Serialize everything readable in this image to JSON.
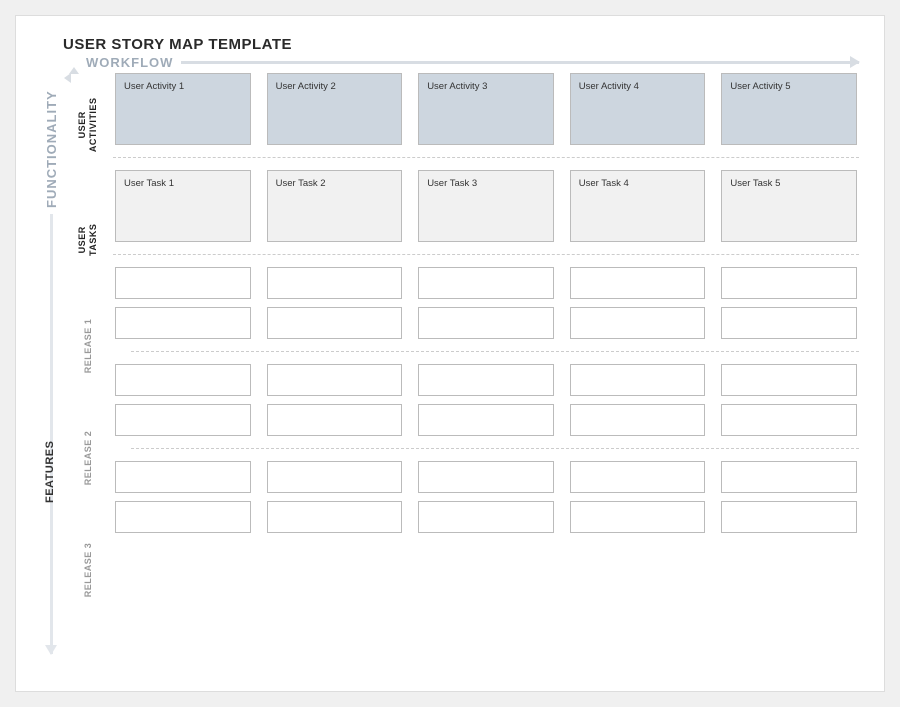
{
  "title": "USER STORY MAP TEMPLATE",
  "workflow_label": "WORKFLOW",
  "functionality_label": "FUNCTIONALITY",
  "features_label": "FEATURES",
  "section_labels": {
    "activities": "USER\nACTIVITIES",
    "tasks": "USER\nTASKS",
    "release1": "RELEASE 1",
    "release2": "RELEASE 2",
    "release3": "RELEASE 3"
  },
  "activities": [
    "User Activity 1",
    "User Activity 2",
    "User Activity 3",
    "User Activity 4",
    "User Activity 5"
  ],
  "tasks": [
    "User Task 1",
    "User Task 2",
    "User Task 3",
    "User Task 4",
    "User Task 5"
  ],
  "releases": [
    {
      "name": "RELEASE 1",
      "rows": [
        [
          "",
          "",
          "",
          "",
          ""
        ],
        [
          "",
          "",
          "",
          "",
          ""
        ]
      ]
    },
    {
      "name": "RELEASE 2",
      "rows": [
        [
          "",
          "",
          "",
          "",
          ""
        ],
        [
          "",
          "",
          "",
          "",
          ""
        ]
      ]
    },
    {
      "name": "RELEASE 3",
      "rows": [
        [
          "",
          "",
          "",
          "",
          ""
        ],
        [
          "",
          "",
          "",
          "",
          ""
        ]
      ]
    }
  ]
}
